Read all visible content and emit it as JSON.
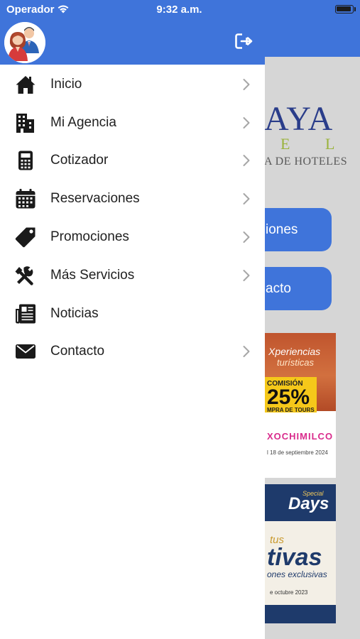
{
  "status_bar": {
    "carrier": "Operador",
    "time": "9:32 a.m."
  },
  "background_screen": {
    "logo_main": "AYA",
    "logo_sub": "E L",
    "logo_tagline": "A DE HOTELES",
    "buttons": [
      "iones",
      "acto"
    ],
    "promo_1": {
      "title_line1": "Xperiencias",
      "title_line2": "turísticas",
      "commission_label": "COMISIÓN",
      "commission_value": "25%",
      "tours_label": "MPRA DE TOURS",
      "brand": "XOCHIMILCO",
      "date": "l 18 de septiembre 2024"
    },
    "promo_2": {
      "special": "Special",
      "days": "Days",
      "line1": "tus",
      "line2": "tivas",
      "line3": "ones exclusivas",
      "date": "e octubre 2023"
    }
  },
  "drawer": {
    "header_color": "#3f74da",
    "avatar_icon": "users-avatar-icon",
    "logout_icon": "logout-icon",
    "menu": [
      {
        "label": "Inicio",
        "icon": "home-icon",
        "has_chevron": true
      },
      {
        "label": "Mi Agencia",
        "icon": "building-icon",
        "has_chevron": true
      },
      {
        "label": "Cotizador",
        "icon": "calculator-icon",
        "has_chevron": true
      },
      {
        "label": "Reservaciones",
        "icon": "calendar-icon",
        "has_chevron": true
      },
      {
        "label": "Promociones",
        "icon": "tag-icon",
        "has_chevron": true
      },
      {
        "label": "Más Servicios",
        "icon": "tools-icon",
        "has_chevron": true
      },
      {
        "label": "Noticias",
        "icon": "newspaper-icon",
        "has_chevron": false
      },
      {
        "label": "Contacto",
        "icon": "envelope-icon",
        "has_chevron": true
      }
    ]
  }
}
